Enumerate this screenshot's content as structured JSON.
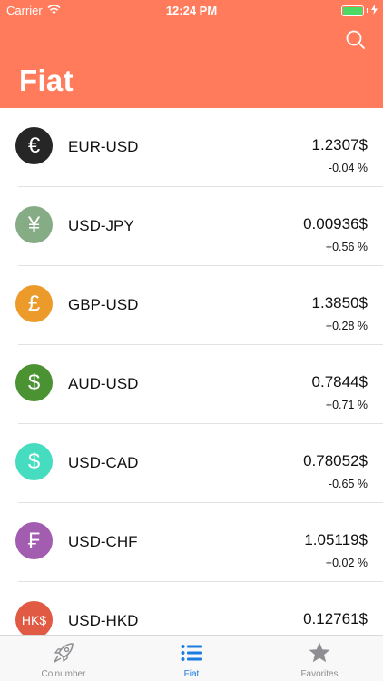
{
  "status_bar": {
    "carrier": "Carrier",
    "time": "12:24 PM"
  },
  "header": {
    "title": "Fiat",
    "background": "#ff7b5c"
  },
  "rates": [
    {
      "pair": "EUR-USD",
      "price": "1.2307$",
      "change": "-0.04 %",
      "symbol": "€",
      "icon": "euro-icon",
      "color": "#262626"
    },
    {
      "pair": "USD-JPY",
      "price": "0.00936$",
      "change": "+0.56 %",
      "symbol": "¥",
      "icon": "yen-icon",
      "color": "#86ac86"
    },
    {
      "pair": "GBP-USD",
      "price": "1.3850$",
      "change": "+0.28 %",
      "symbol": "£",
      "icon": "pound-icon",
      "color": "#ec9a2a"
    },
    {
      "pair": "AUD-USD",
      "price": "0.7844$",
      "change": "+0.71 %",
      "symbol": "$",
      "icon": "dollar-icon",
      "color": "#4b9233"
    },
    {
      "pair": "USD-CAD",
      "price": "0.78052$",
      "change": "-0.65 %",
      "symbol": "$",
      "icon": "dollar-icon",
      "color": "#45dcc0"
    },
    {
      "pair": "USD-CHF",
      "price": "1.05119$",
      "change": "+0.02 %",
      "symbol": "₣",
      "icon": "franc-icon",
      "color": "#a25cb0"
    },
    {
      "pair": "USD-HKD",
      "price": "0.12761$",
      "change": "",
      "symbol": "HK$",
      "icon": "hkd-icon",
      "color": "#e05a44"
    }
  ],
  "tabs": [
    {
      "label": "Coinumber",
      "icon": "rocket-icon",
      "active": false
    },
    {
      "label": "Fiat",
      "icon": "list-icon",
      "active": true
    },
    {
      "label": "Favorites",
      "icon": "star-icon",
      "active": false
    }
  ],
  "colors": {
    "accent": "#1a7ce0",
    "inactive": "#8e8e93",
    "battery": "#4cd964"
  }
}
